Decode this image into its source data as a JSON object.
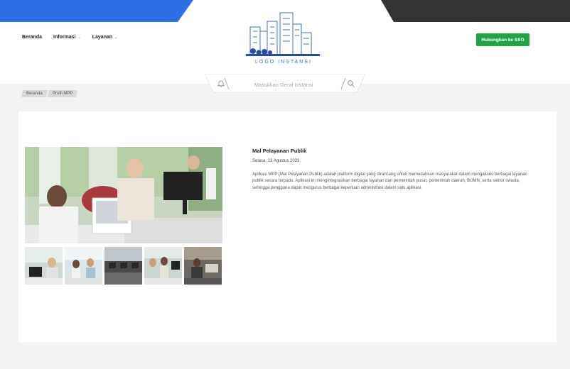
{
  "header": {
    "nav": [
      {
        "label": "Beranda",
        "has_dropdown": false
      },
      {
        "label": "Informasi",
        "has_dropdown": true
      },
      {
        "label": "Layanan",
        "has_dropdown": true
      }
    ],
    "logo_text": "LOGO INSTANSI",
    "sso_button": "Hubungkan ke SSO",
    "search_placeholder": "Masukkan Gerai Instansi"
  },
  "breadcrumb": [
    "Beranda",
    "Profil MPP"
  ],
  "content": {
    "title": "Mal Pelayanan Publik",
    "date": "Selasa, 13 Agustus 2023",
    "description": "Aplikasi MPP (Mal Pelayanan Publik) adalah platform digital yang dirancang untuk memudahkan masyarakat dalam mengakses berbagai layanan publik secara terpadu. Aplikasi ini mengintegrasikan berbagai layanan dari pemerintah pusat, pemerintah daerah, BUMN, serta sektor swasta, sehingga pengguna dapat mengurus berbagai keperluan administrasi dalam satu aplikasi."
  },
  "colors": {
    "brand_blue": "#2f6fe6",
    "dark_strip": "#333333",
    "sso_green": "#20a447",
    "logo_blue": "#3c6fc4"
  },
  "icons": [
    "chevron-down-icon",
    "bell-icon",
    "search-icon",
    "city-skyline-logo"
  ]
}
